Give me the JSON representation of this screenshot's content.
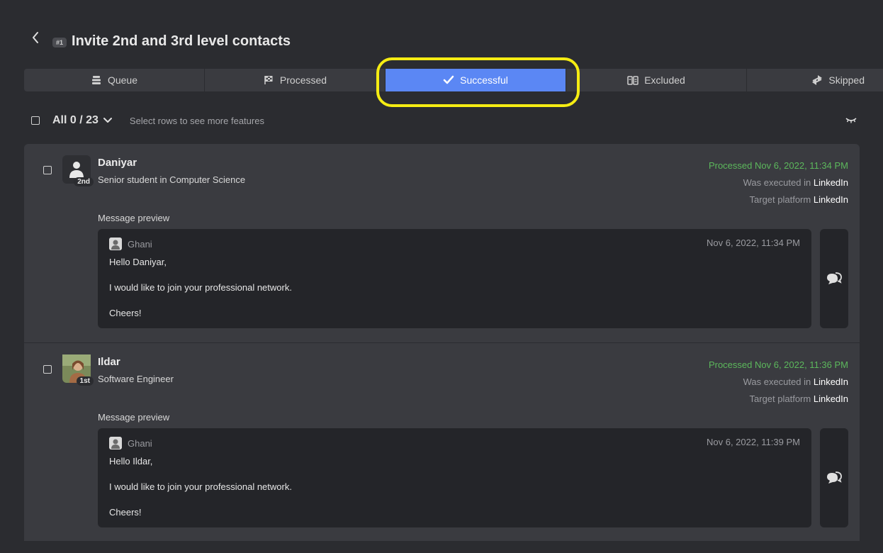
{
  "header": {
    "badge": "#1",
    "title": "Invite 2nd and 3rd level contacts"
  },
  "tabs": [
    {
      "label": "Queue",
      "icon": "stack-icon"
    },
    {
      "label": "Processed",
      "icon": "checkered-flag-icon"
    },
    {
      "label": "Successful",
      "icon": "check-icon",
      "active": true
    },
    {
      "label": "Excluded",
      "icon": "excluded-icon"
    },
    {
      "label": "Skipped",
      "icon": "skip-arrows-icon"
    }
  ],
  "selection": {
    "all_label": "All 0 / 23",
    "hint": "Select rows to see more features"
  },
  "rows": [
    {
      "name": "Daniyar",
      "title": "Senior student in Computer Science",
      "degree": "2nd",
      "processed": "Processed Nov 6, 2022, 11:34 PM",
      "executed_label": "Was executed in",
      "executed_platform": "LinkedIn",
      "target_label": "Target platform",
      "target_platform": "LinkedIn",
      "message_preview_label": "Message preview",
      "message": {
        "sender": "Ghani",
        "time": "Nov 6, 2022, 11:34 PM",
        "greeting": "Hello Daniyar,",
        "body": "I would like to join your professional network.",
        "closing": "Cheers!"
      }
    },
    {
      "name": "Ildar",
      "title": "Software Engineer",
      "degree": "1st",
      "processed": "Processed Nov 6, 2022, 11:36 PM",
      "executed_label": "Was executed in",
      "executed_platform": "LinkedIn",
      "target_label": "Target platform",
      "target_platform": "LinkedIn",
      "message_preview_label": "Message preview",
      "message": {
        "sender": "Ghani",
        "time": "Nov 6, 2022, 11:39 PM",
        "greeting": "Hello Ildar,",
        "body": "I would like to join your professional network.",
        "closing": "Cheers!"
      }
    }
  ],
  "colors": {
    "background": "#2b2c30",
    "active_tab": "#5b87f4",
    "processed_text": "#5cb85c",
    "highlight": "#f5ec13"
  }
}
